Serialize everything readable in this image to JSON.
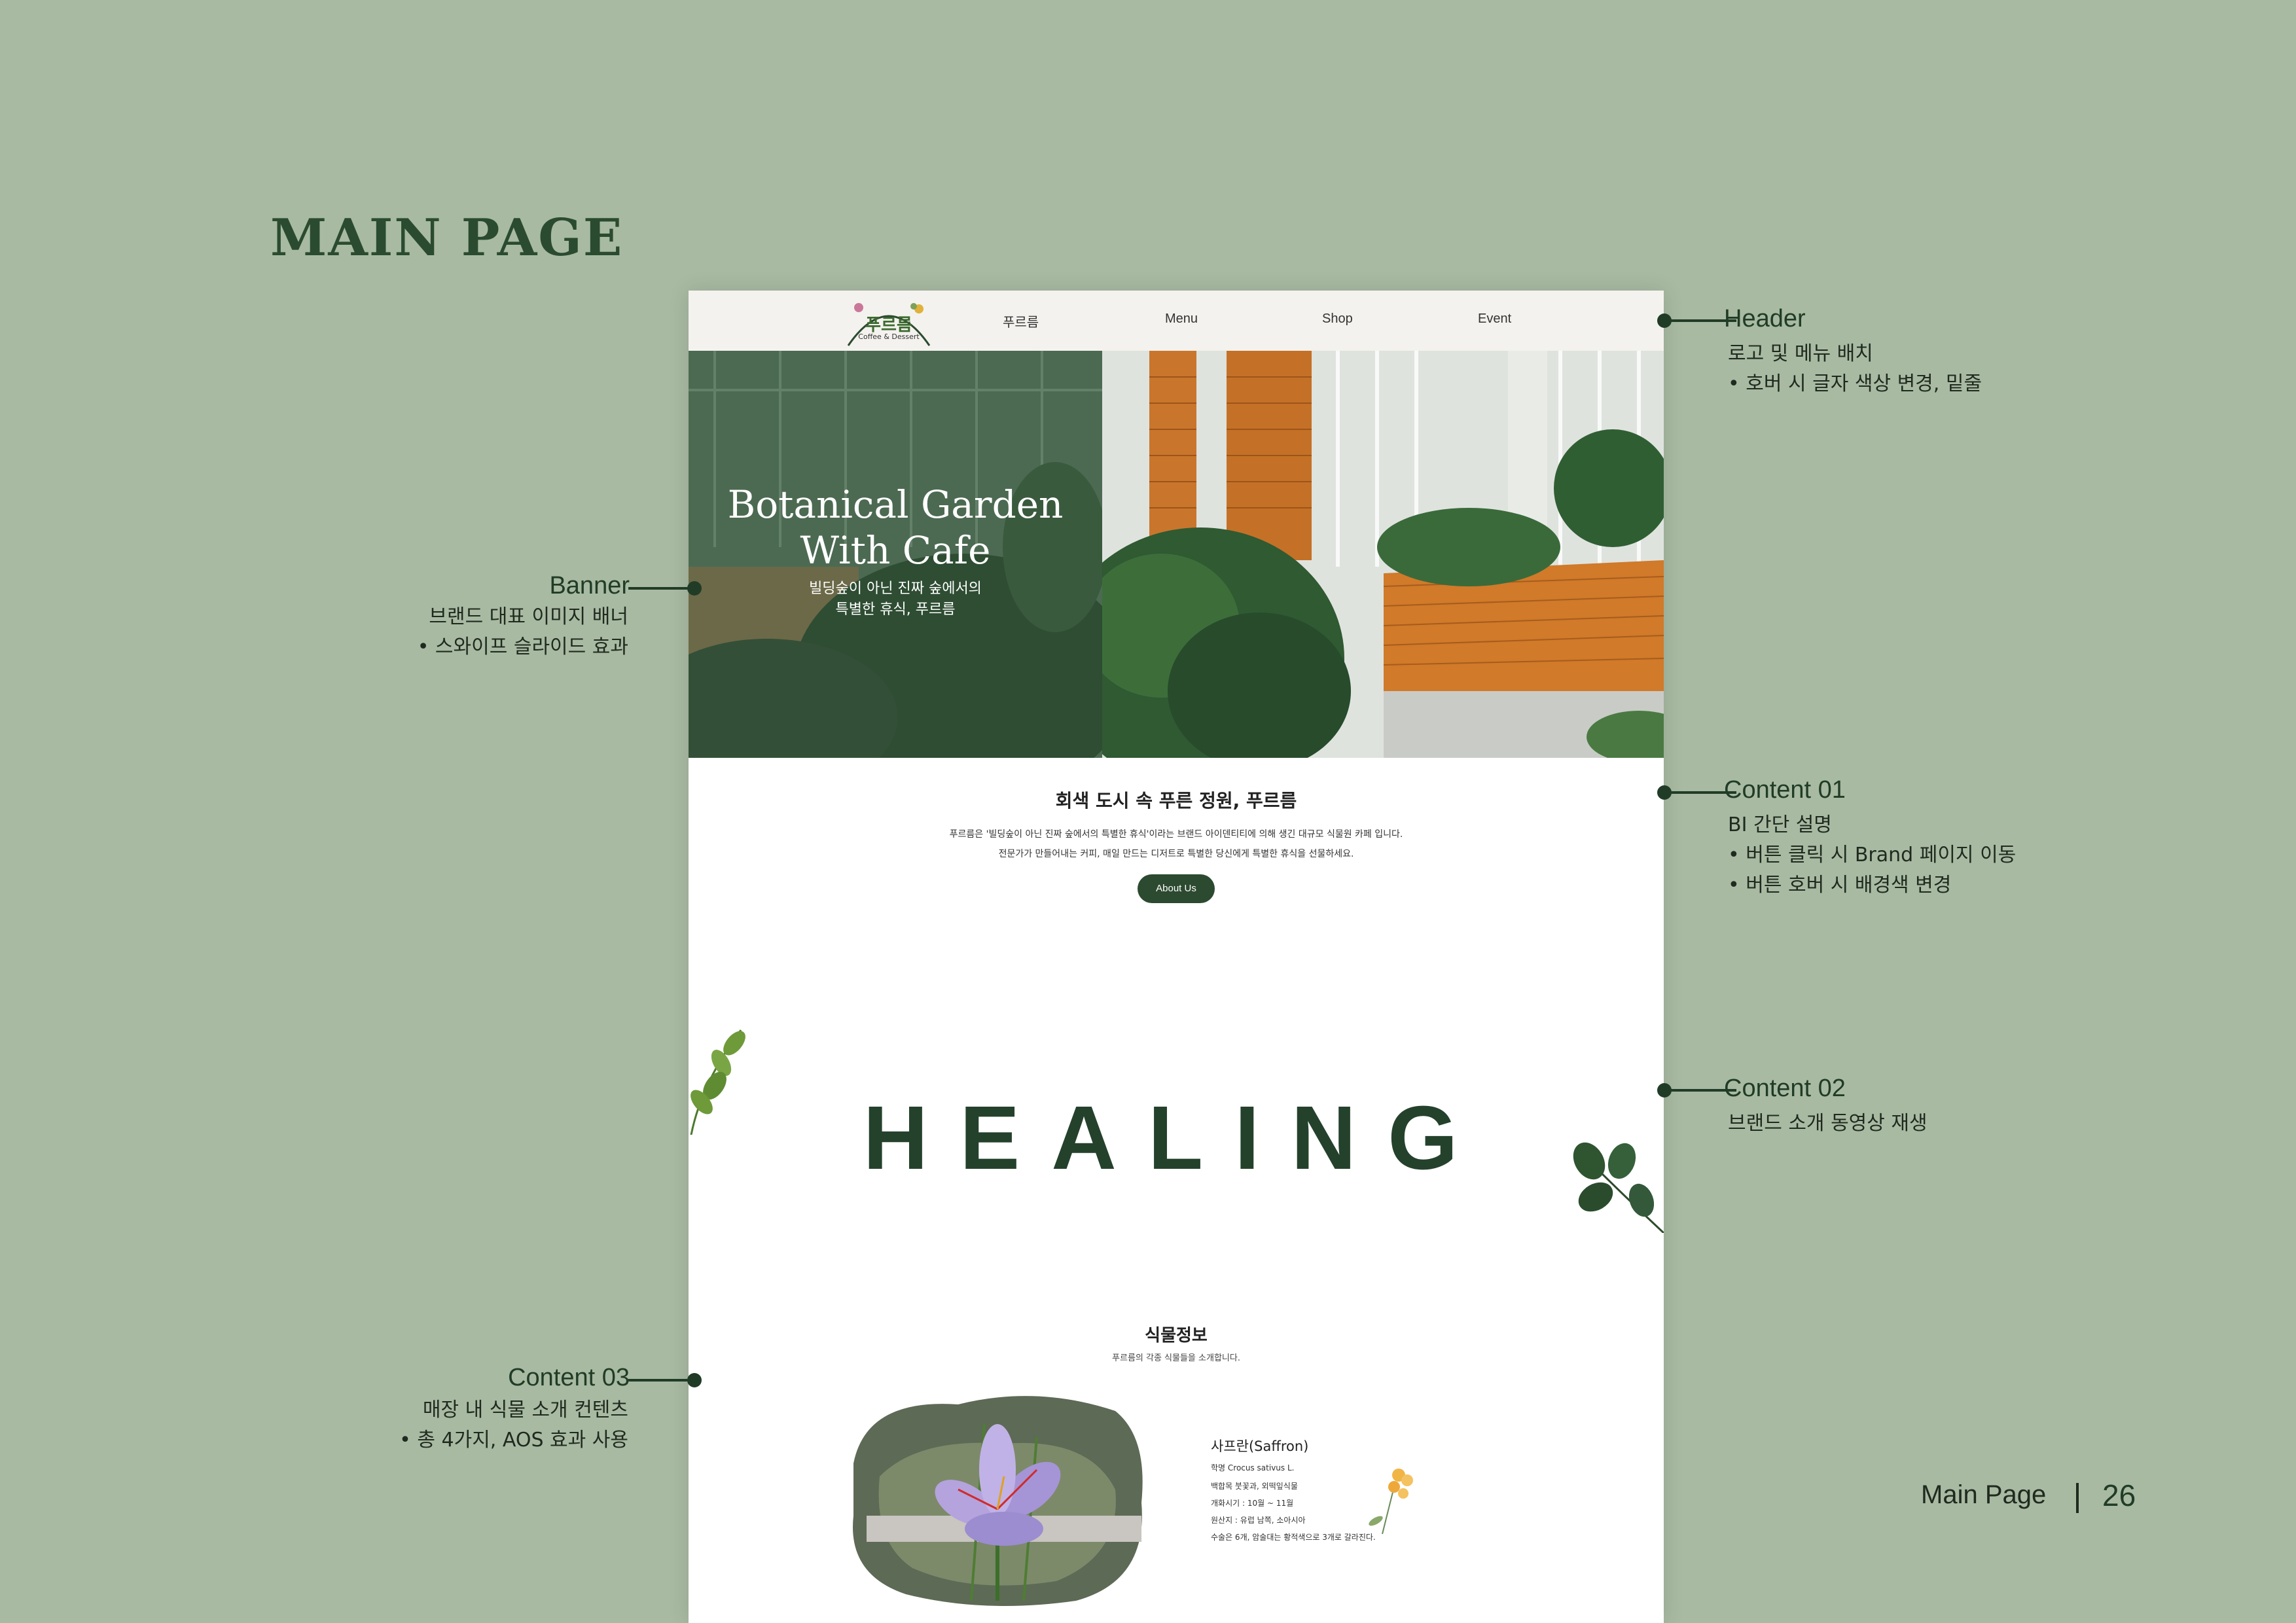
{
  "page": {
    "title": "MAIN PAGE",
    "footer_label": "Main Page",
    "footer_number": "26"
  },
  "mock": {
    "header": {
      "logo_text": "푸르름",
      "logo_sub": "Coffee & Dessert",
      "nav": [
        "푸르름",
        "Menu",
        "Shop",
        "Event"
      ]
    },
    "banner": {
      "title_line1": "Botanical Garden",
      "title_line2": "With Cafe",
      "sub_line1": "빌딩숲이 아닌 진짜 숲에서의",
      "sub_line2": "특별한 휴식, 푸르름"
    },
    "content01": {
      "title": "회색 도시 속 푸른 정원, 푸르름",
      "line1": "푸르름은 '빌딩숲이 아닌 진짜 숲에서의 특별한 휴식'이라는 브랜드 아이덴티티에 의해 생긴 대규모 식물원 카페 입니다.",
      "line2": "전문가가 만들어내는 커피, 매일 만드는 디저트로 특별한 당신에게 특별한 휴식을 선물하세요.",
      "button": "About Us"
    },
    "content02": {
      "word": "HEALING"
    },
    "content03": {
      "title": "식물정보",
      "subtitle": "푸르름의 각종 식물들을 소개합니다.",
      "plant_name": "사프란(Saffron)",
      "details": [
        "학명 Crocus sativus L.",
        "백합목 붓꽃과, 외떡잎식물",
        "개화시기 : 10월 ~ 11월",
        "원산지 : 유럽 남쪽, 소아시아",
        "수술은 6개, 암술대는 황적색으로 3개로 갈라진다."
      ]
    }
  },
  "annotations": {
    "header": {
      "title": "Header",
      "lines": [
        "로고 및 메뉴 배치",
        "• 호버 시 글자 색상 변경, 밑줄"
      ]
    },
    "banner": {
      "title": "Banner",
      "lines": [
        "브랜드 대표 이미지 배너",
        "• 스와이프 슬라이드 효과"
      ]
    },
    "content01": {
      "title": "Content 01",
      "lines": [
        "BI 간단 설명",
        "• 버튼 클릭 시 Brand 페이지 이동",
        "• 버튼 호버 시 배경색 변경"
      ]
    },
    "content02": {
      "title": "Content 02",
      "lines": [
        "브랜드 소개 동영상 재생"
      ]
    },
    "content03": {
      "title": "Content 03",
      "lines": [
        "매장 내 식물 소개 컨텐츠",
        "• 총 4가지, AOS 효과 사용"
      ]
    }
  },
  "colors": {
    "background": "#a8baa2",
    "accent_dark_green": "#213c26",
    "button_green": "#2c4a30",
    "header_bg": "#f4f2ee"
  }
}
